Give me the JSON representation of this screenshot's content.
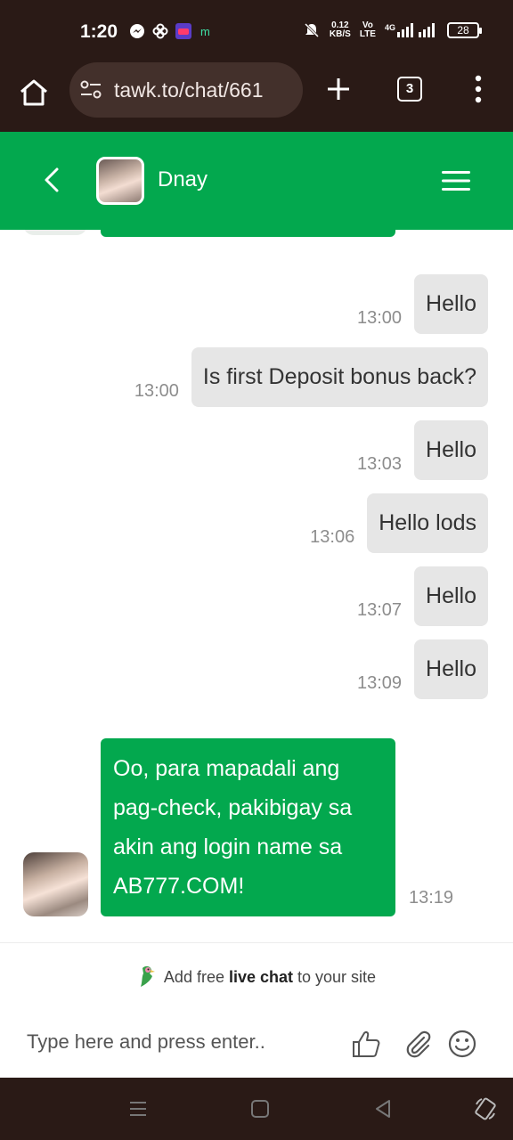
{
  "status_bar": {
    "time": "1:20",
    "net_speed_top": "0.12",
    "net_speed_unit": "KB/S",
    "volte_top": "Vo",
    "volte_bottom": "LTE",
    "network": "4G",
    "battery": "28"
  },
  "browser": {
    "url": "tawk.to/chat/661",
    "tab_count": "3"
  },
  "chat_header": {
    "agent_name": "Dnay"
  },
  "messages": [
    {
      "text": "Hello",
      "time": "13:00"
    },
    {
      "text": "Is first Deposit bonus back?",
      "time": "13:00"
    },
    {
      "text": "Hello",
      "time": "13:03"
    },
    {
      "text": "Hello lods",
      "time": "13:06"
    },
    {
      "text": "Hello",
      "time": "13:07"
    },
    {
      "text": "Hello",
      "time": "13:09"
    }
  ],
  "agent_message": {
    "text": "Oo, para mapadali ang pag-check, pakibigay sa akin ang login name sa AB777.COM!",
    "time": "13:19"
  },
  "footer": {
    "branding_prefix": "Add free ",
    "branding_bold": "live chat",
    "branding_suffix": " to your site",
    "input_placeholder": "Type here and press enter.."
  },
  "colors": {
    "brand_green": "#03a84e",
    "outgoing_bubble": "#e6e6e6",
    "system_bar": "#2a1a16"
  }
}
